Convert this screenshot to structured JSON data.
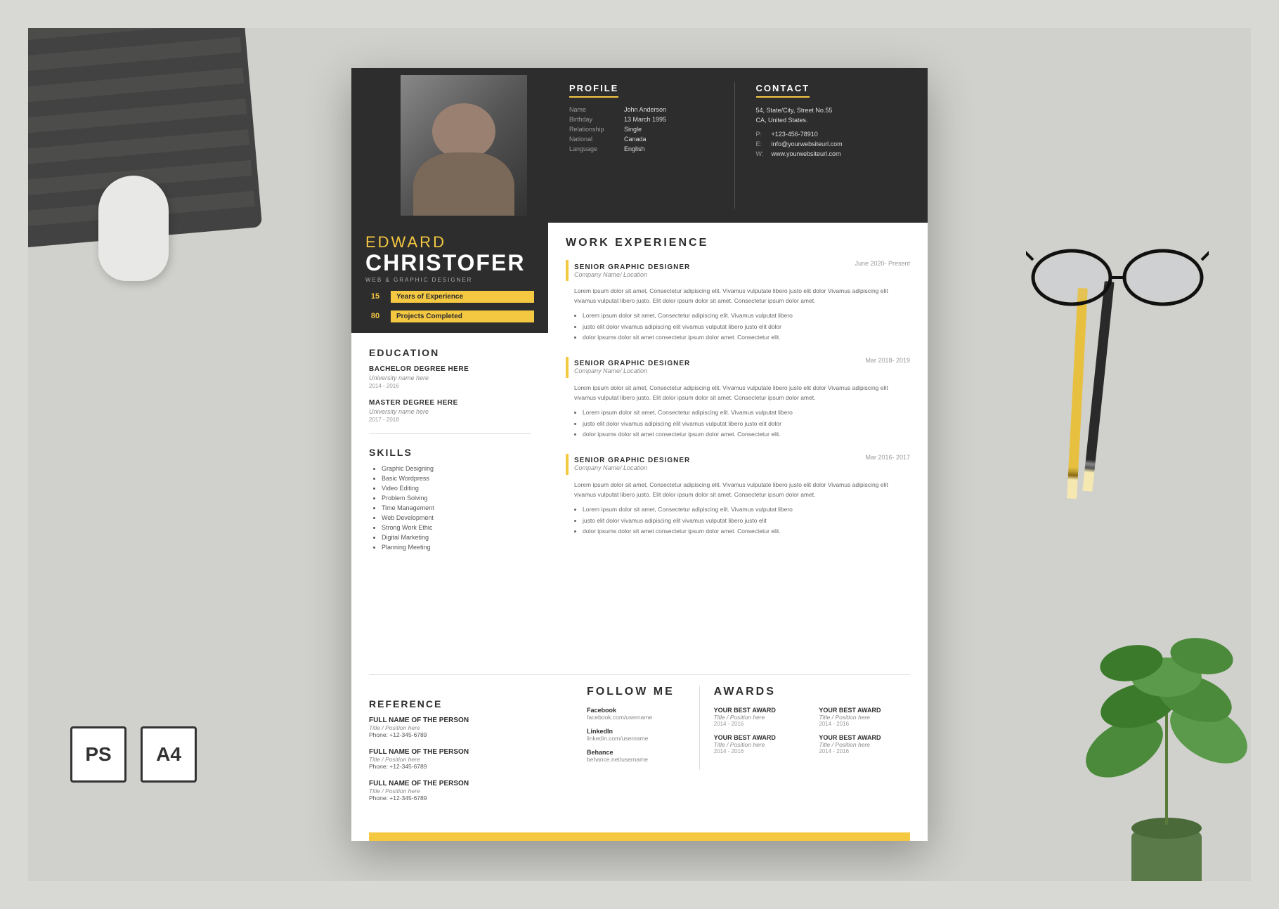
{
  "scene": {
    "badges": [
      "PS",
      "A4"
    ]
  },
  "header": {
    "profile_title": "PROFILE",
    "contact_title": "CONTACT",
    "profile_fields": [
      {
        "label": "Name",
        "value": "John Anderson"
      },
      {
        "label": "Birthday",
        "value": "13 March 1995"
      },
      {
        "label": "Relationship",
        "value": "Single"
      },
      {
        "label": "National",
        "value": "Canada"
      },
      {
        "label": "Language",
        "value": "English"
      }
    ],
    "contact_address": "54, State/City, Street No.55\nCA, United States.",
    "contact_items": [
      {
        "key": "P:",
        "value": "+123-456-78910"
      },
      {
        "key": "E:",
        "value": "info@yourwebsiteurl.com"
      },
      {
        "key": "W:",
        "value": "www.yourwebsiteurl.com"
      }
    ]
  },
  "name": {
    "first": "EDWARD",
    "last": "CHRISTOFER",
    "title": "WEB & GRAPHIC DESIGNER"
  },
  "stats": [
    {
      "num": "15",
      "label": "Years of Experience"
    },
    {
      "num": "80",
      "label": "Projects Completed"
    }
  ],
  "education": {
    "section_title": "EDUCATION",
    "items": [
      {
        "degree": "BACHELOR DEGREE HERE",
        "university": "University name here",
        "years": "2014 - 2016"
      },
      {
        "degree": "MASTER DEGREE HERE",
        "university": "University name here",
        "years": "2017 - 2018"
      }
    ]
  },
  "skills": {
    "section_title": "SKILLS",
    "items": [
      "Graphic Designing",
      "Basic Wordpress",
      "Video Editing",
      "Problem Solving",
      "Time Management",
      "Web Development",
      "Strong Work Ethic",
      "Digital Marketing",
      "Planning Meeting"
    ]
  },
  "work_experience": {
    "section_title": "WORK EXPERIENCE",
    "jobs": [
      {
        "title": "SENIOR GRAPHIC DESIGNER",
        "company": "Company Name/ Location",
        "date": "June 2020- Present",
        "description": "Lorem ipsum dolor sit amet, Consectetur adipiscing elit. Vivamus vulputate libero justo elit dolor Vivamus adipiscing elit vivamus vulputat libero justo. Elit dolor ipsum dolor sit amet. Consectetur ipsum dolor amet.",
        "bullets": [
          "Lorem ipsum dolor sit amet, Consectetur adipiscing elit. Vivamus vulputat libero",
          "justo elit dolor vivamus adipiscing elit vivamus vulputat libero justo elit dolor",
          "dolor ipsums dolor sit amet consectetur ipsum dolor amet. Consectetur elit."
        ]
      },
      {
        "title": "SENIOR GRAPHIC DESIGNER",
        "company": "Company Name/ Location",
        "date": "Mar 2018- 2019",
        "description": "Lorem ipsum dolor sit amet, Consectetur adipiscing elit. Vivamus vulputate libero justo elit dolor Vivamus adipiscing elit vivamus vulputat libero justo. Elit dolor ipsum dolor sit amet. Consectetur ipsum dolor amet.",
        "bullets": [
          "Lorem ipsum dolor sit amet, Consectetur adipiscing elit. Vivamus vulputat libero",
          "justo elit dolor vivamus adipiscing elit vivamus vulputat libero justo elit dolor",
          "dolor ipsums dolor sit amet consectetur ipsum dolor amet. Consectetur elit."
        ]
      },
      {
        "title": "SENIOR GRAPHIC DESIGNER",
        "company": "Company Name/ Location",
        "date": "Mar 2016- 2017",
        "description": "Lorem ipsum dolor sit amet, Consectetur adipiscing elit. Vivamus vulputate libero justo elit dolor Vivamus adipiscing elit vivamus vulputat libero justo. Elit dolor ipsum dolor sit amet. Consectetur ipsum dolor amet.",
        "bullets": [
          "Lorem ipsum dolor sit amet, Consectetur adipiscing elit. Vivamus vulputat libero",
          "justo elit dolor vivamus adipiscing elit vivamus vulputat libero justo elit",
          "dolor ipsums dolor sit amet consectetur ipsum dolor amet. Consectetur elit."
        ]
      }
    ]
  },
  "reference": {
    "section_title": "REFERENCE",
    "items": [
      {
        "name": "FULL NAME OF THE PERSON",
        "title": "Title / Position here",
        "phone": "Phone: +12-345-6789"
      },
      {
        "name": "FULL NAME OF THE PERSON",
        "title": "Title / Position here",
        "phone": "Phone: +12-345-6789"
      },
      {
        "name": "FULL NAME OF THE PERSON",
        "title": "Title / Position here",
        "phone": "Phone: +12-345-6789"
      }
    ]
  },
  "follow_me": {
    "title": "FOLLOW ME",
    "items": [
      {
        "platform": "Facebook",
        "url": "facebook.com/username"
      },
      {
        "platform": "LinkedIn",
        "url": "linkedin.com/username"
      },
      {
        "platform": "Behance",
        "url": "behance.net/username"
      }
    ]
  },
  "awards": {
    "title": "AWARDS",
    "items": [
      {
        "name": "YOUR BEST AWARD",
        "title": "Title / Position here",
        "year": "2014 - 2016"
      },
      {
        "name": "YOUR BEST AWARD",
        "title": "Title / Position here",
        "year": "2014 - 2016"
      },
      {
        "name": "YOUR BEST AWARD",
        "title": "Title / Position here",
        "year": "2014 - 2016"
      },
      {
        "name": "YOUR BEST AWARD",
        "title": "Title / Position here",
        "year": "2014 - 2016"
      }
    ]
  }
}
